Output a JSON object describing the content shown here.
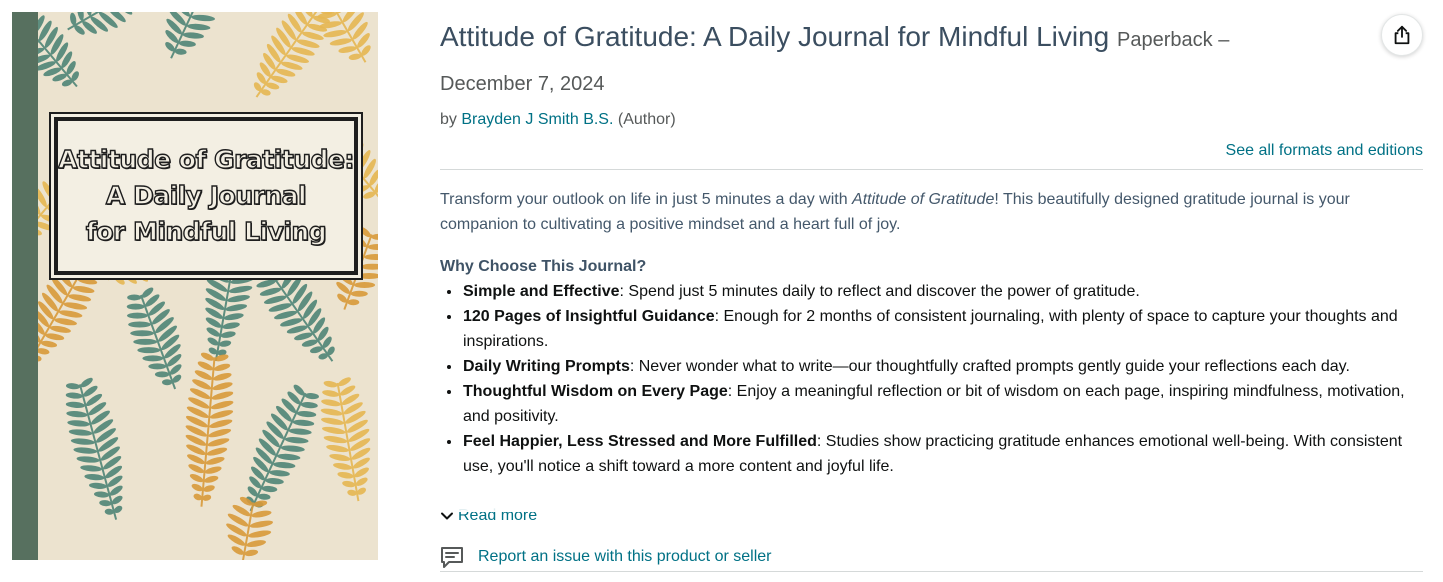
{
  "cover": {
    "title_lines": [
      "Attitude of Gratitude:",
      "A Daily Journal",
      "for Mindful Living"
    ],
    "colors": {
      "spine": "#57705f",
      "background": "#ece3cf",
      "fern_green": "#4f8577",
      "fern_orange": "#d99a3a",
      "fern_gold": "#e6b752"
    }
  },
  "product": {
    "title": "Attitude of Gratitude: A Daily Journal for Mindful Living",
    "format": "Paperback",
    "format_separator": "–",
    "date": "December 7, 2024",
    "byline_prefix": "by",
    "author": "Brayden J Smith B.S.",
    "author_role": "(Author)",
    "share_icon": "share-icon"
  },
  "formats_link": "See all formats and editions",
  "description": {
    "intro_before": "Transform your outlook on life in just 5 minutes a day with ",
    "intro_italic": "Attitude of Gratitude",
    "intro_after": "! This beautifully designed gratitude journal is your companion to cultivating a positive mindset and a heart full of joy.",
    "subhead": "Why Choose This Journal?",
    "bullets": [
      {
        "bold": "Simple and Effective",
        "text": ": Spend just 5 minutes daily to reflect and discover the power of gratitude."
      },
      {
        "bold": "120 Pages of Insightful Guidance",
        "text": ": Enough for 2 months of consistent journaling, with plenty of space to capture your thoughts and inspirations."
      },
      {
        "bold": "Daily Writing Prompts",
        "text": ": Never wonder what to write—our thoughtfully crafted prompts gently guide your reflections each day."
      },
      {
        "bold": "Thoughtful Wisdom on Every Page",
        "text": ": Enjoy a meaningful reflection or bit of wisdom on each page, inspiring mindfulness, motivation, and positivity."
      },
      {
        "bold": "Feel Happier, Less Stressed and More Fulfilled",
        "text": ": Studies show practicing gratitude enhances emotional well-being. With consistent use, you'll notice a shift toward a more content and joyful life."
      }
    ]
  },
  "read_more": "Read more",
  "report_link": "Report an issue with this product or seller",
  "colors": {
    "link": "#007185",
    "title": "#3b4e60",
    "secondary": "#565959",
    "divider": "#d5d9d9"
  }
}
